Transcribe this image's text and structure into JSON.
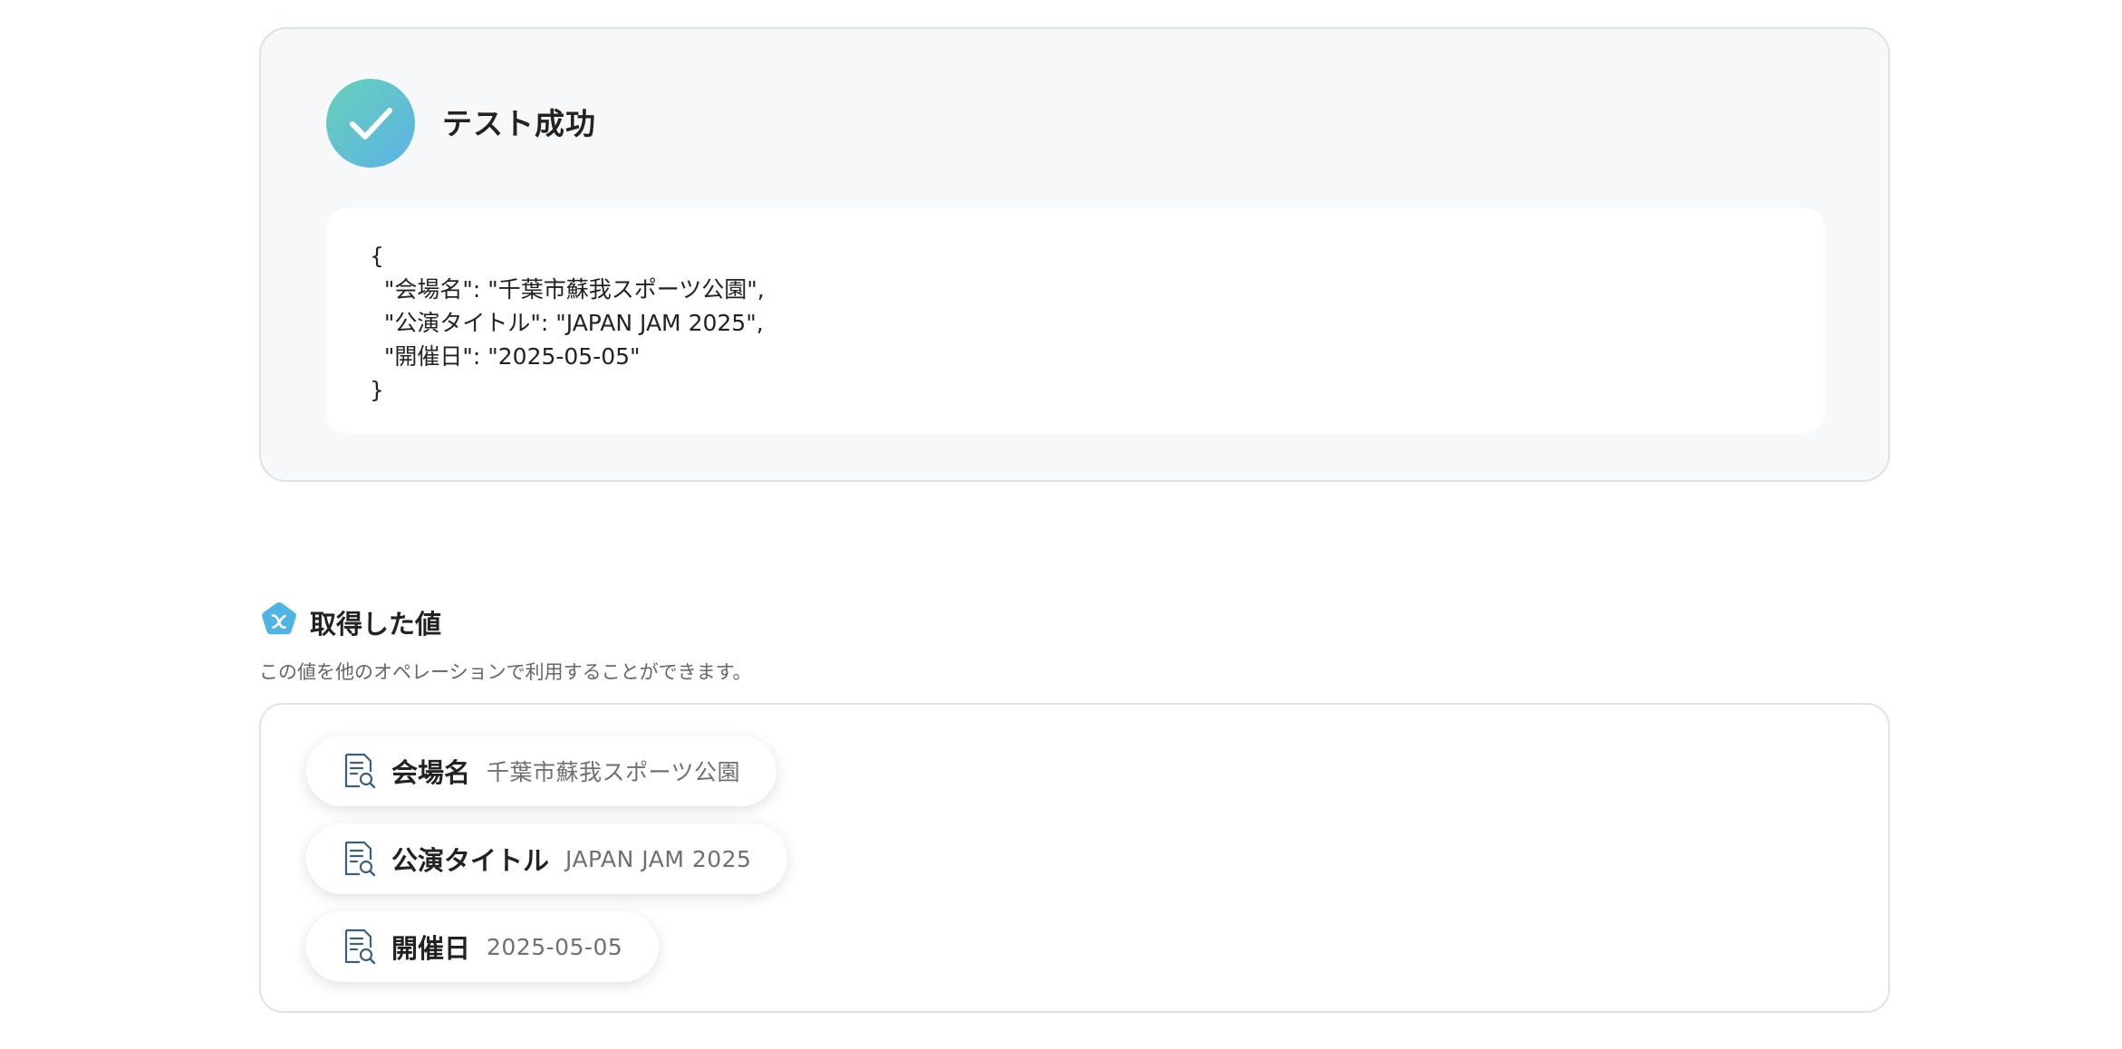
{
  "test_result": {
    "status_title": "テスト成功",
    "json_lines": [
      "{",
      "  \"会場名\": \"千葉市蘇我スポーツ公園\",",
      "  \"公演タイトル\": \"JAPAN JAM 2025\",",
      "  \"開催日\": \"2025-05-05\"",
      "}"
    ]
  },
  "retrieved_values": {
    "title": "取得した値",
    "description": "この値を他のオペレーションで利用することができます。",
    "items": [
      {
        "label": "会場名",
        "value": "千葉市蘇我スポーツ公園"
      },
      {
        "label": "公演タイトル",
        "value": "JAPAN JAM 2025"
      },
      {
        "label": "開催日",
        "value": "2025-05-05"
      }
    ]
  },
  "colors": {
    "success_gradient_start": "#67d0b9",
    "success_gradient_end": "#5cb3e6",
    "variable_icon": "#4fb3e3",
    "chip_icon_stroke": "#3d5f7a"
  },
  "icons": {
    "status": "check-circle-icon",
    "section": "variable-x-pentagon-icon",
    "chip": "document-search-icon"
  }
}
